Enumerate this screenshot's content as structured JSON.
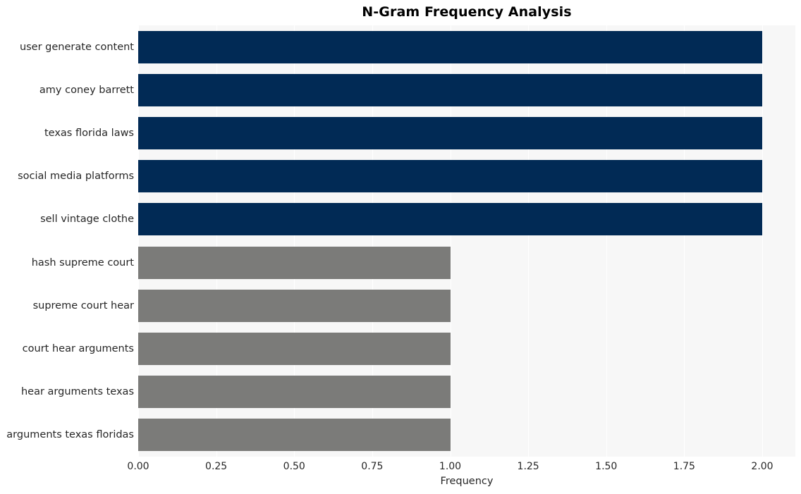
{
  "chart_data": {
    "type": "bar",
    "orientation": "horizontal",
    "title": "N-Gram Frequency Analysis",
    "xlabel": "Frequency",
    "ylabel": "",
    "xlim": [
      0,
      2
    ],
    "ylim": [
      0,
      10
    ],
    "grid": true,
    "legend": false,
    "xticks": [
      "0.00",
      "0.25",
      "0.50",
      "0.75",
      "1.00",
      "1.25",
      "1.50",
      "1.75",
      "2.00"
    ],
    "xtick_values": [
      0,
      0.25,
      0.5,
      0.75,
      1,
      1.25,
      1.5,
      1.75,
      2
    ],
    "categories": [
      "user generate content",
      "amy coney barrett",
      "texas florida laws",
      "social media platforms",
      "sell vintage clothe",
      "hash supreme court",
      "supreme court hear",
      "court hear arguments",
      "hear arguments texas",
      "arguments texas floridas"
    ],
    "values": [
      2,
      2,
      2,
      2,
      2,
      1,
      1,
      1,
      1,
      1
    ],
    "bar_colors": [
      "#012a55",
      "#012a55",
      "#012a55",
      "#012a55",
      "#012a55",
      "#7b7b79",
      "#7b7b79",
      "#7b7b79",
      "#7b7b79",
      "#7b7b79"
    ],
    "colors": {
      "high_frequency": "#012a55",
      "low_frequency": "#7b7b79",
      "plot_background": "#f7f7f7",
      "figure_background": "#ffffff",
      "gridline": "#ffffff",
      "text": "#262626",
      "title": "#000000"
    }
  }
}
